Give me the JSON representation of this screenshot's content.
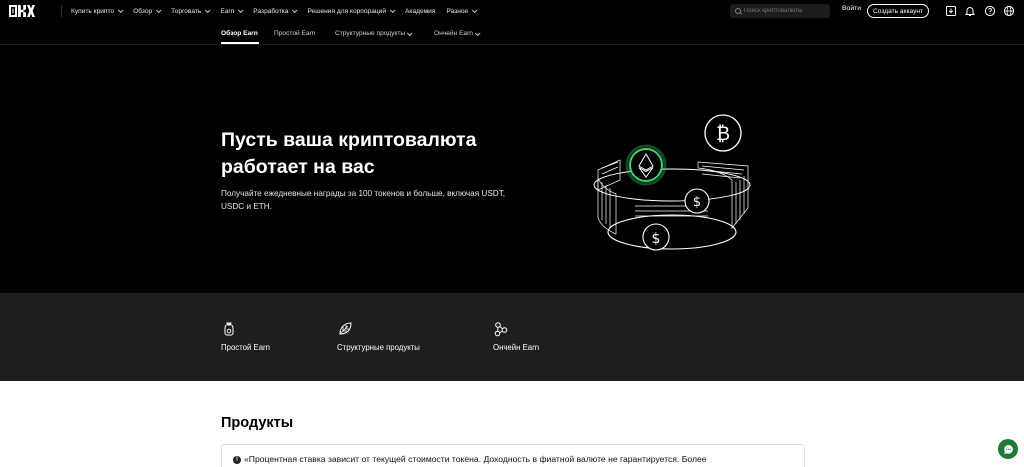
{
  "nav": {
    "menu": [
      {
        "label": "Купить крипто",
        "chevron": true
      },
      {
        "label": "Обзор",
        "chevron": true
      },
      {
        "label": "Торговать",
        "chevron": true
      },
      {
        "label": "Earn",
        "chevron": true
      },
      {
        "label": "Разработка",
        "chevron": true
      },
      {
        "label": "Решения для корпораций",
        "chevron": true
      },
      {
        "label": "Академия",
        "chevron": false
      },
      {
        "label": "Разное",
        "chevron": true
      }
    ],
    "search_placeholder": "Поиск криптовалюты",
    "login_label": "Войти",
    "signup_label": "Создать аккаунт",
    "icons": [
      "download-icon",
      "bell-icon",
      "help-icon",
      "globe-icon"
    ]
  },
  "subnav": {
    "tabs": [
      {
        "label": "Обзор Earn",
        "active": true,
        "chevron": false
      },
      {
        "label": "Простой Earn",
        "active": false,
        "chevron": false
      },
      {
        "label": "Структурные продукты",
        "active": false,
        "chevron": true
      },
      {
        "label": "Ончейн Earn",
        "active": false,
        "chevron": true
      }
    ]
  },
  "hero": {
    "title_line1": "Пусть ваша криптовалюта",
    "title_line2": "работает на вас",
    "subtitle_line1": "Получайте ежедневные награды за 100 токенов и больше, включая USDT,",
    "subtitle_line2": "USDC и ETH.",
    "accent_color": "#3dd26b"
  },
  "features": [
    {
      "label": "Простой Earn",
      "icon": "money-bag-icon"
    },
    {
      "label": "Структурные продукты",
      "icon": "structured-leaf-icon"
    },
    {
      "label": "Ончейн Earn",
      "icon": "chain-nodes-icon"
    }
  ],
  "products": {
    "title": "Продукты",
    "notice_icon": "!",
    "notice_text": "«Процентная ставка зависит от текущей стоимости токена. Доходность в фиатной валюте не гарантируется. Более"
  },
  "chat_button": {
    "icon": "chat-icon",
    "color": "#1f7a3a"
  }
}
